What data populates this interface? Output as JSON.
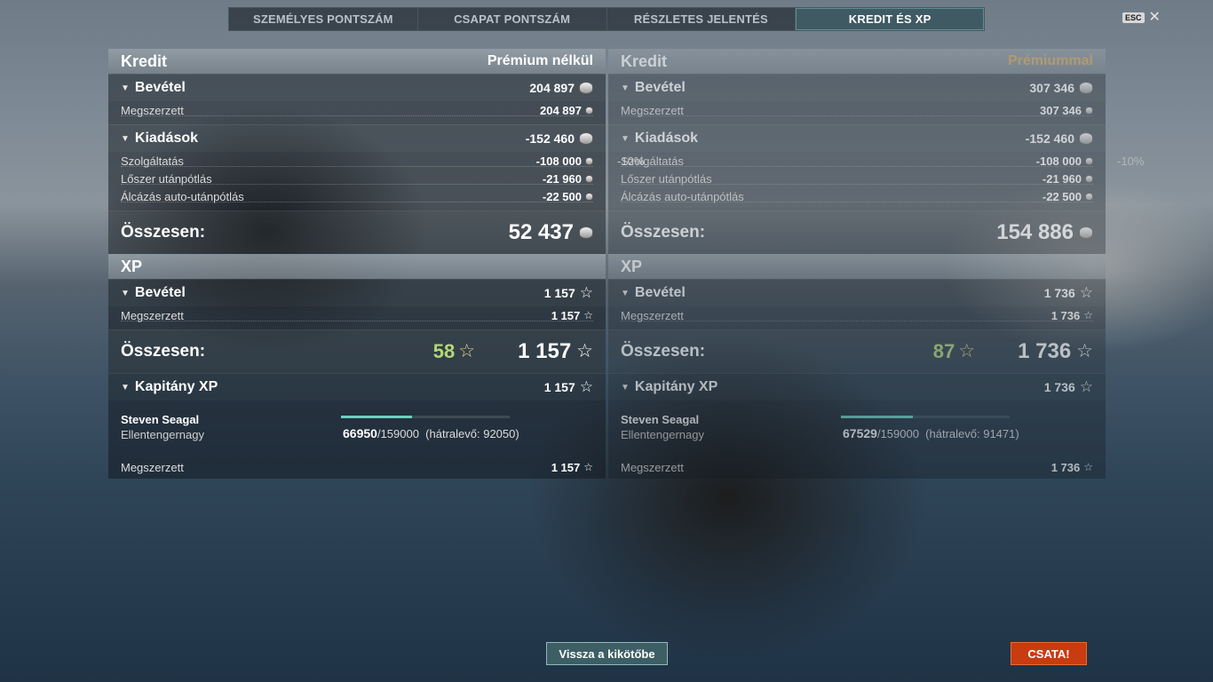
{
  "tabs": [
    {
      "label": "SZEMÉLYES PONTSZÁM"
    },
    {
      "label": "CSAPAT PONTSZÁM"
    },
    {
      "label": "RÉSZLETES JELENTÉS"
    },
    {
      "label": "KREDIT ÉS XP"
    }
  ],
  "active_tab": "KREDIT ÉS XP",
  "esc_label": "ESC",
  "labels": {
    "credit": "Kredit",
    "income": "Bevétel",
    "earned": "Megszerzett",
    "expenses": "Kiadások",
    "service": "Szolgáltatás",
    "ammo": "Lőszer utánpótlás",
    "camo": "Álcázás auto-utánpótlás",
    "total": "Összesen:",
    "xp": "XP",
    "captain_xp": "Kapitány XP",
    "captain_name": "Steven Seagal",
    "captain_rank": "Ellentengernagy",
    "remaining_prefix": "(hátralevő: ",
    "remaining_suffix": ")"
  },
  "left": {
    "title": "Prémium nélkül",
    "credit_income": "204 897",
    "credit_earned": "204 897",
    "expenses_total": "-152 460",
    "service_pct": "-10%",
    "service": "-108 000",
    "ammo": "-21 960",
    "camo": "-22 500",
    "credit_total": "52 437",
    "xp_income": "1 157",
    "xp_earned": "1 157",
    "xp_bonus": "58",
    "xp_total": "1 157",
    "captain_xp": "1 157",
    "captain_current": "66950",
    "captain_max": "/159000",
    "captain_remaining": "92050",
    "captain_progress": 0.421,
    "captain_earned": "1 157"
  },
  "right": {
    "title": "Prémiummal",
    "credit_income": "307 346",
    "credit_earned": "307 346",
    "expenses_total": "-152 460",
    "service_pct": "-10%",
    "service": "-108 000",
    "ammo": "-21 960",
    "camo": "-22 500",
    "credit_total": "154 886",
    "xp_income": "1 736",
    "xp_earned": "1 736",
    "xp_bonus": "87",
    "xp_total": "1 736",
    "captain_xp": "1 736",
    "captain_current": "67529",
    "captain_max": "/159000",
    "captain_remaining": "91471",
    "captain_progress": 0.425,
    "captain_earned": "1 736"
  },
  "buttons": {
    "port": "Vissza a kikötőbe",
    "battle": "CSATA!"
  },
  "colors": {
    "active_tab": "#3f5a63",
    "premium_gold": "#d6a95c",
    "bonus_green": "#b5d67a",
    "progress": "#6fd0c0",
    "battle_button": "#c93b10"
  }
}
